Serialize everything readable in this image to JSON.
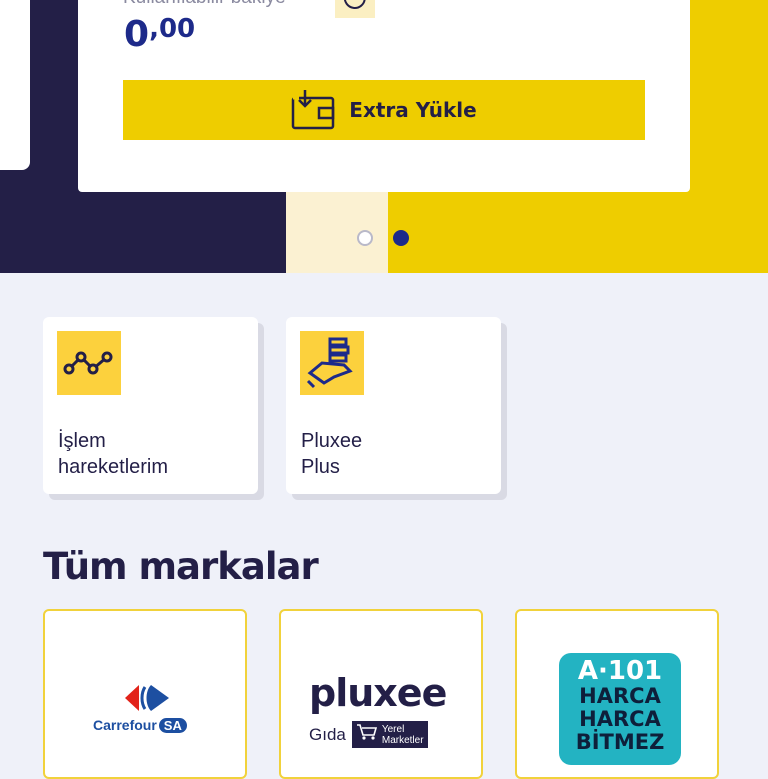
{
  "balance": {
    "label": "Kullanılabilir bakiye",
    "amount_int": "0",
    "amount_dec": ",00"
  },
  "extra_button": {
    "label": "Extra Yükle"
  },
  "quick_actions": [
    {
      "label_line1": "İşlem",
      "label_line2": "hareketlerim",
      "icon": "chart-line-icon"
    },
    {
      "label_line1": "Pluxee",
      "label_line2": "Plus",
      "icon": "hand-coins-icon"
    }
  ],
  "brands": {
    "title": "Tüm markalar",
    "items": [
      {
        "name": "Carrefour",
        "suffix": "SA"
      },
      {
        "name": "pluxee",
        "sub": "Gıda",
        "badge_line1": "Yerel",
        "badge_line2": "Marketler"
      },
      {
        "name_top": "A·101",
        "line1": "HARCA",
        "line2": "HARCA",
        "line3": "BİTMEZ"
      }
    ]
  },
  "colors": {
    "navy": "#231f47",
    "yellow": "#eecd00",
    "blue": "#1d2a8a",
    "page_bg": "#eff1f9"
  }
}
